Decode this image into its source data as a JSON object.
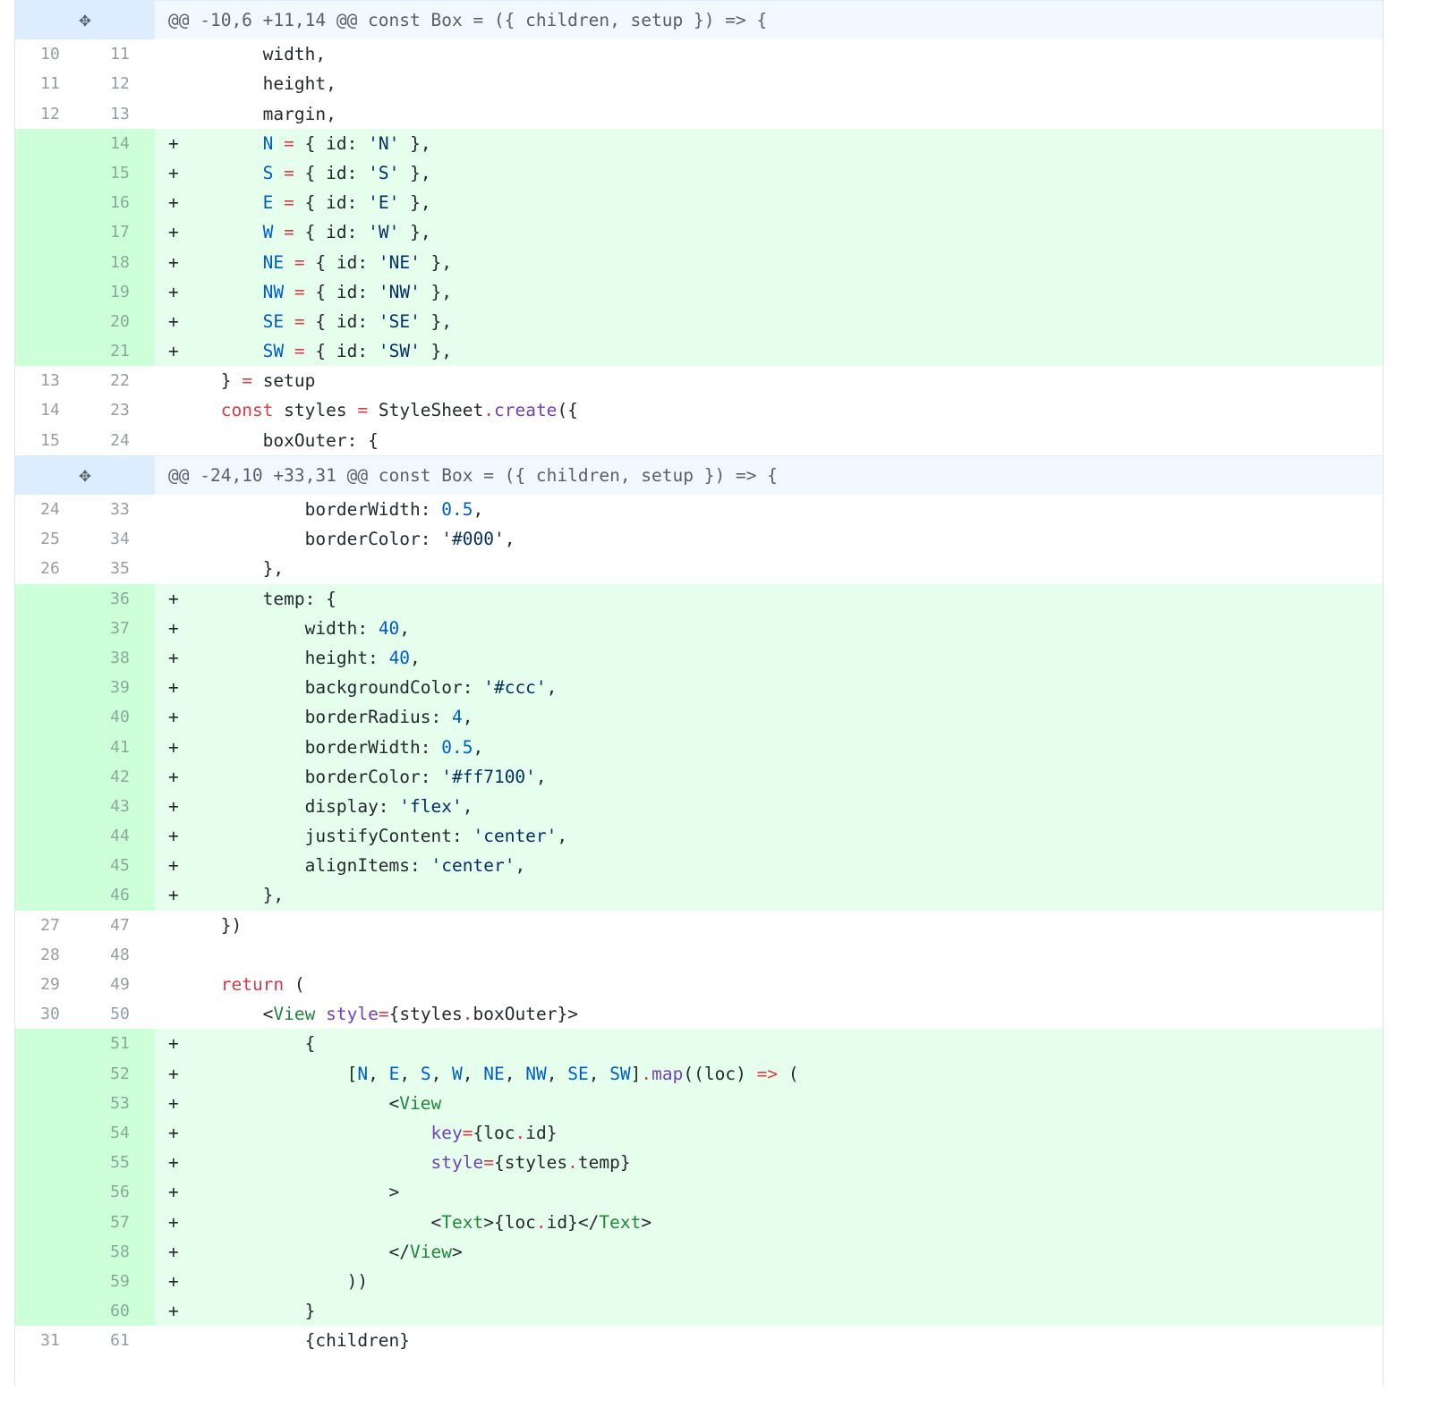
{
  "diff": {
    "hunks": [
      {
        "header": "@@ -10,6 +11,14 @@ const Box = ({ children, setup }) => {",
        "expand_icon": "unfold-icon"
      },
      {
        "header": "@@ -24,10 +33,31 @@ const Box = ({ children, setup }) => {",
        "expand_icon": "unfold-icon"
      }
    ],
    "top_partial": {
      "old": "",
      "new": ""
    },
    "lines": [
      {
        "old": "10",
        "new": "11",
        "marker": " ",
        "text": "        width,"
      },
      {
        "old": "11",
        "new": "12",
        "marker": " ",
        "text": "        height,"
      },
      {
        "old": "12",
        "new": "13",
        "marker": " ",
        "text": "        margin,"
      },
      {
        "old": "",
        "new": "14",
        "marker": "+",
        "text": "        N = { id: 'N' },"
      },
      {
        "old": "",
        "new": "15",
        "marker": "+",
        "text": "        S = { id: 'S' },"
      },
      {
        "old": "",
        "new": "16",
        "marker": "+",
        "text": "        E = { id: 'E' },"
      },
      {
        "old": "",
        "new": "17",
        "marker": "+",
        "text": "        W = { id: 'W' },"
      },
      {
        "old": "",
        "new": "18",
        "marker": "+",
        "text": "        NE = { id: 'NE' },"
      },
      {
        "old": "",
        "new": "19",
        "marker": "+",
        "text": "        NW = { id: 'NW' },"
      },
      {
        "old": "",
        "new": "20",
        "marker": "+",
        "text": "        SE = { id: 'SE' },"
      },
      {
        "old": "",
        "new": "21",
        "marker": "+",
        "text": "        SW = { id: 'SW' },"
      },
      {
        "old": "13",
        "new": "22",
        "marker": " ",
        "text": "    } = setup"
      },
      {
        "old": "14",
        "new": "23",
        "marker": " ",
        "text": "    const styles = StyleSheet.create({"
      },
      {
        "old": "15",
        "new": "24",
        "marker": " ",
        "text": "        boxOuter: {"
      },
      {
        "hunk": 1
      },
      {
        "old": "24",
        "new": "33",
        "marker": " ",
        "text": "            borderWidth: 0.5,"
      },
      {
        "old": "25",
        "new": "34",
        "marker": " ",
        "text": "            borderColor: '#000',"
      },
      {
        "old": "26",
        "new": "35",
        "marker": " ",
        "text": "        },"
      },
      {
        "old": "",
        "new": "36",
        "marker": "+",
        "text": "        temp: {"
      },
      {
        "old": "",
        "new": "37",
        "marker": "+",
        "text": "            width: 40,"
      },
      {
        "old": "",
        "new": "38",
        "marker": "+",
        "text": "            height: 40,"
      },
      {
        "old": "",
        "new": "39",
        "marker": "+",
        "text": "            backgroundColor: '#ccc',"
      },
      {
        "old": "",
        "new": "40",
        "marker": "+",
        "text": "            borderRadius: 4,"
      },
      {
        "old": "",
        "new": "41",
        "marker": "+",
        "text": "            borderWidth: 0.5,"
      },
      {
        "old": "",
        "new": "42",
        "marker": "+",
        "text": "            borderColor: '#ff7100',"
      },
      {
        "old": "",
        "new": "43",
        "marker": "+",
        "text": "            display: 'flex',"
      },
      {
        "old": "",
        "new": "44",
        "marker": "+",
        "text": "            justifyContent: 'center',"
      },
      {
        "old": "",
        "new": "45",
        "marker": "+",
        "text": "            alignItems: 'center',"
      },
      {
        "old": "",
        "new": "46",
        "marker": "+",
        "text": "        },"
      },
      {
        "old": "27",
        "new": "47",
        "marker": " ",
        "text": "    })"
      },
      {
        "old": "28",
        "new": "48",
        "marker": " ",
        "text": ""
      },
      {
        "old": "29",
        "new": "49",
        "marker": " ",
        "text": "    return ("
      },
      {
        "old": "30",
        "new": "50",
        "marker": " ",
        "text": "        <View style={styles.boxOuter}>"
      },
      {
        "old": "",
        "new": "51",
        "marker": "+",
        "text": "            {"
      },
      {
        "old": "",
        "new": "52",
        "marker": "+",
        "text": "                [N, E, S, W, NE, NW, SE, SW].map((loc) => ("
      },
      {
        "old": "",
        "new": "53",
        "marker": "+",
        "text": "                    <View"
      },
      {
        "old": "",
        "new": "54",
        "marker": "+",
        "text": "                        key={loc.id}"
      },
      {
        "old": "",
        "new": "55",
        "marker": "+",
        "text": "                        style={styles.temp}"
      },
      {
        "old": "",
        "new": "56",
        "marker": "+",
        "text": "                    >"
      },
      {
        "old": "",
        "new": "57",
        "marker": "+",
        "text": "                        <Text>{loc.id}</Text>"
      },
      {
        "old": "",
        "new": "58",
        "marker": "+",
        "text": "                    </View>"
      },
      {
        "old": "",
        "new": "59",
        "marker": "+",
        "text": "                ))"
      },
      {
        "old": "",
        "new": "60",
        "marker": "+",
        "text": "            }"
      },
      {
        "old": "31",
        "new": "61",
        "marker": " ",
        "text": "            {children}"
      },
      {
        "old": "",
        "new": "",
        "marker": " ",
        "text": ""
      }
    ]
  },
  "colors": {
    "added_bg": "#e6ffed",
    "added_num_bg": "#cdffd8",
    "hunk_bg": "#f1f8ff",
    "hunk_num_bg": "#dbedff",
    "keyword": "#d73a49",
    "constant": "#005cc5",
    "string": "#032f62",
    "function": "#6f42c1",
    "tag": "#22863a"
  }
}
